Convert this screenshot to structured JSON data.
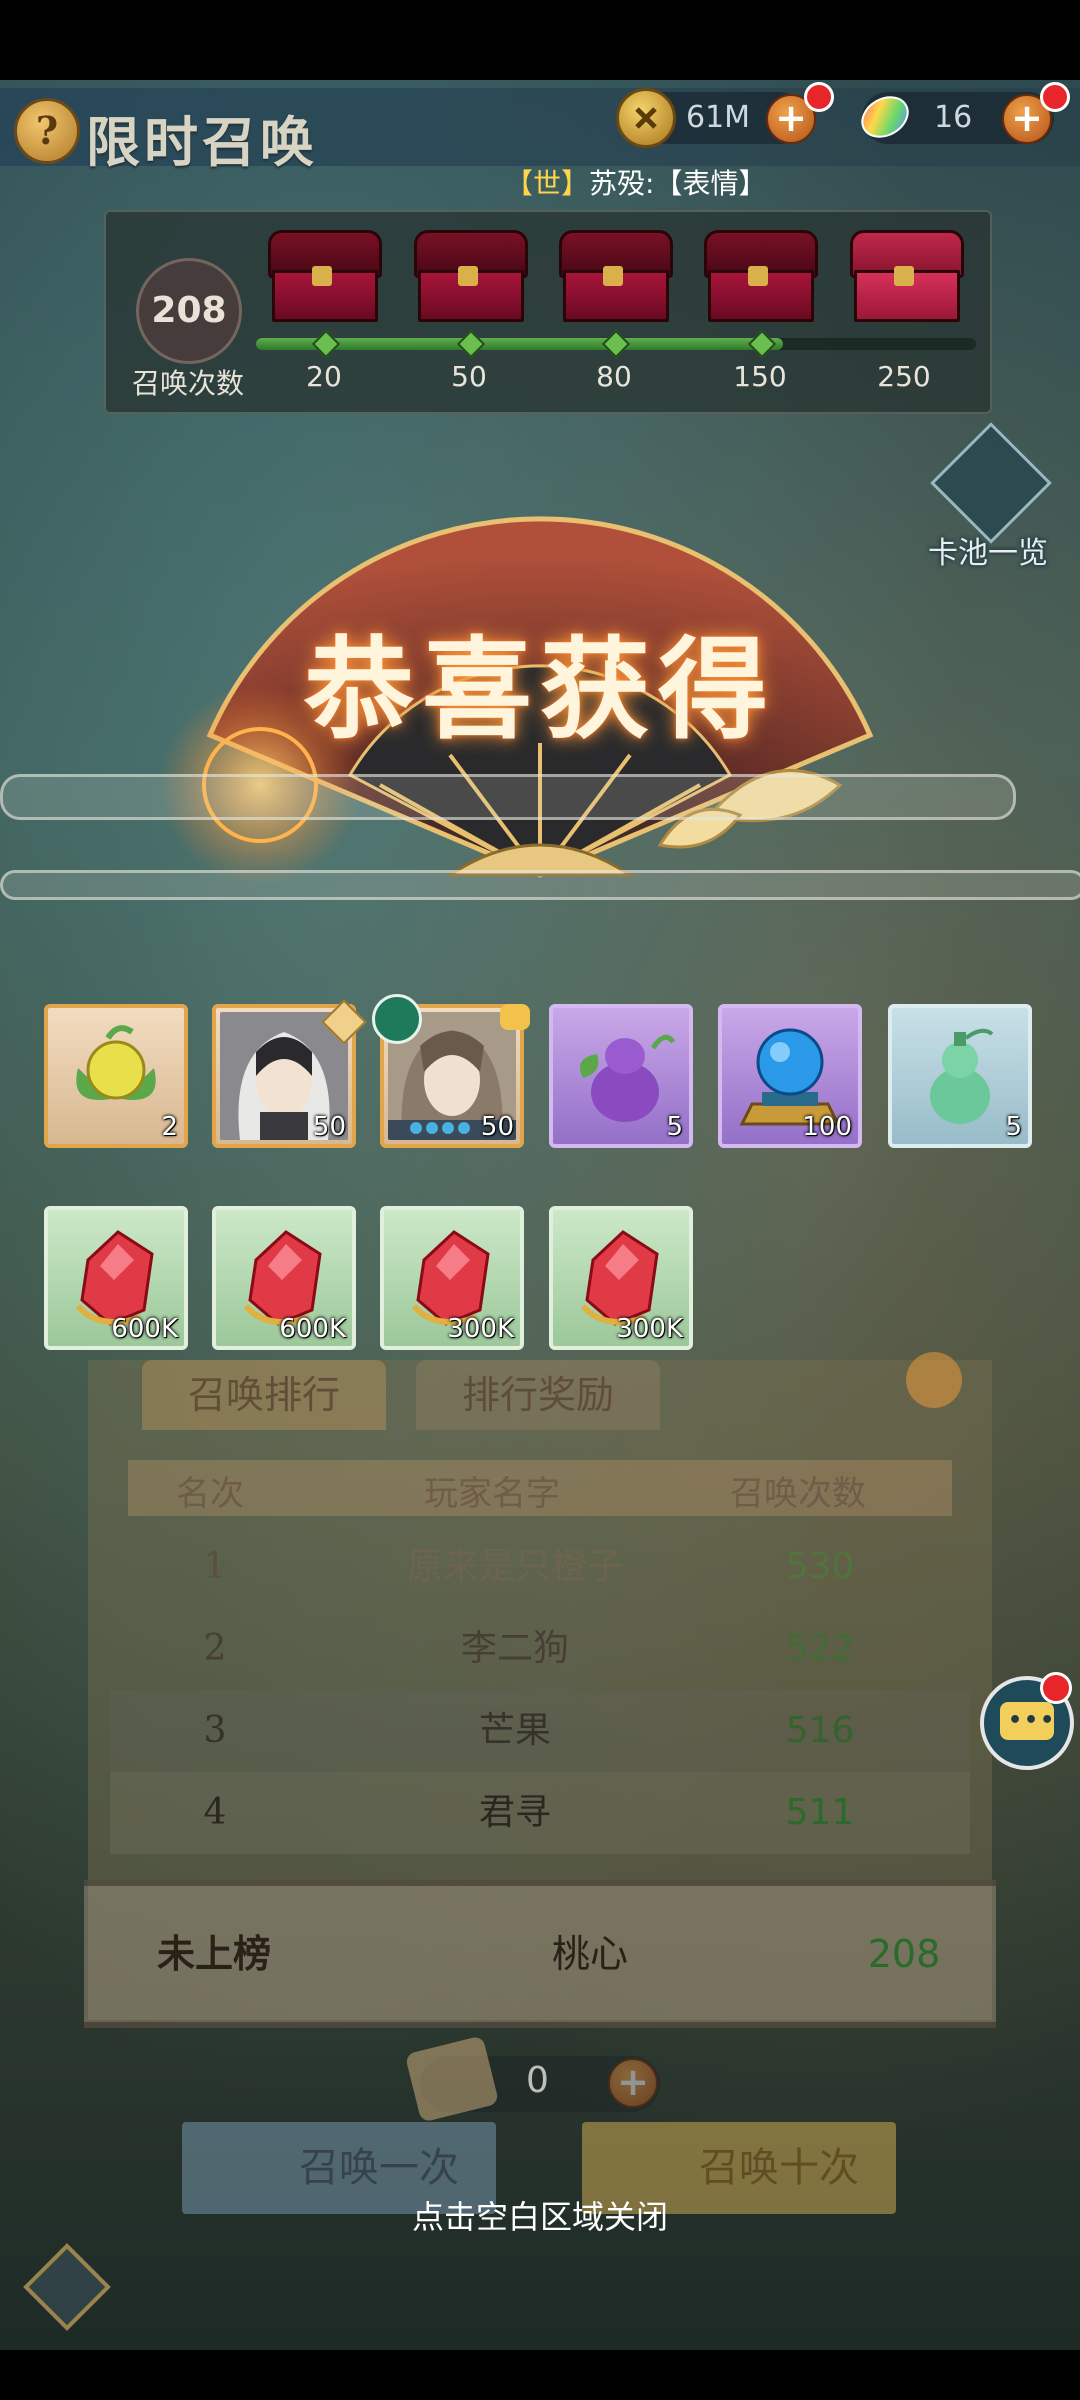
{
  "header": {
    "help_icon": "?",
    "title": "限时召唤",
    "coins": "61M",
    "gems": "16",
    "plus": "+"
  },
  "chat": {
    "channel": "【世】",
    "message": "苏殁:【表情】"
  },
  "progress": {
    "count": "208",
    "count_label": "召唤次数",
    "milestones": [
      "20",
      "50",
      "80",
      "150",
      "250"
    ],
    "current": 208,
    "max": 250
  },
  "pool_button": {
    "label": "卡池一览"
  },
  "banner": {
    "title": "恭喜获得"
  },
  "rewards": {
    "row1": [
      {
        "name": "golden-orb-item",
        "qty": "2",
        "rarity": "gold"
      },
      {
        "name": "white-hair-hero-card",
        "qty": "50",
        "rarity": "gold"
      },
      {
        "name": "brown-hair-hero-card",
        "qty": "50",
        "rarity": "gold"
      },
      {
        "name": "purple-gourd-item",
        "qty": "5",
        "rarity": "purple"
      },
      {
        "name": "blue-sphere-item",
        "qty": "100",
        "rarity": "purple"
      },
      {
        "name": "green-gourd-item",
        "qty": "5",
        "rarity": "teal"
      }
    ],
    "row2": [
      {
        "name": "red-crystal-item",
        "qty": "600K",
        "rarity": "green"
      },
      {
        "name": "red-crystal-item",
        "qty": "600K",
        "rarity": "green"
      },
      {
        "name": "red-crystal-item",
        "qty": "300K",
        "rarity": "green"
      },
      {
        "name": "red-crystal-item",
        "qty": "300K",
        "rarity": "green"
      }
    ]
  },
  "ranking": {
    "tabs": [
      "召唤排行",
      "排行奖励"
    ],
    "headers": [
      "名次",
      "玩家名字",
      "召唤次数"
    ],
    "rows": [
      {
        "rank": "1",
        "name": "原来是只橙子",
        "count": "530"
      },
      {
        "rank": "2",
        "name": "李二狗",
        "count": "522"
      },
      {
        "rank": "3",
        "name": "芒果",
        "count": "516"
      },
      {
        "rank": "4",
        "name": "君寻",
        "count": "511"
      }
    ],
    "me": {
      "rank": "未上榜",
      "name": "桃心",
      "count": "208"
    }
  },
  "summon": {
    "scroll_count": "0",
    "once": "召唤一次",
    "ten": "召唤十次"
  },
  "close_hint": "点击空白区域关闭",
  "colors": {
    "accent_gold": "#e2a54a",
    "progress_green": "#5fae4e",
    "notify_red": "#e8262a"
  }
}
